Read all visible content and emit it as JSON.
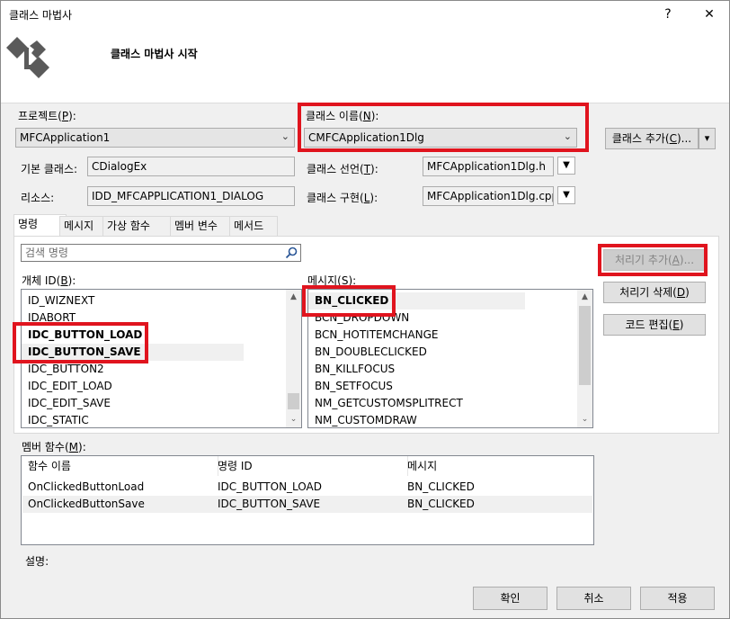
{
  "window": {
    "title": "클래스 마법사",
    "help_label": "?",
    "close_label": "✕"
  },
  "header": {
    "subtitle": "클래스 마법사 시작"
  },
  "project": {
    "label_prefix": "프로젝트(",
    "label_key": "P",
    "label_suffix": "):",
    "value": "MFCApplication1"
  },
  "class_name": {
    "label_prefix": "클래스 이름(",
    "label_key": "N",
    "label_suffix": "):",
    "value": "CMFCApplication1Dlg"
  },
  "add_class": {
    "label_prefix": "클래스 추가(",
    "label_key": "C",
    "label_suffix": ")...",
    "dropdown_glyph": "▾"
  },
  "base_class": {
    "label": "기본 클래스:",
    "value": "CDialogEx"
  },
  "class_decl": {
    "label_prefix": "클래스 선언(",
    "label_key": "T",
    "label_suffix": "):",
    "value": "MFCApplication1Dlg.h"
  },
  "resource": {
    "label": "리소스:",
    "value": "IDD_MFCAPPLICATION1_DIALOG"
  },
  "class_impl": {
    "label_prefix": "클래스 구현(",
    "label_key": "L",
    "label_suffix": "):",
    "value": "MFCApplication1Dlg.cpp"
  },
  "tabs": [
    "명령",
    "메시지",
    "가상 함수",
    "멤버 변수",
    "메서드"
  ],
  "search": {
    "placeholder": "검색 명령"
  },
  "object_ids": {
    "label_prefix": "개체 ID(",
    "label_key": "B",
    "label_suffix": "):",
    "items": [
      "ID_WIZNEXT",
      "IDABORT",
      "IDC_BUTTON_LOAD",
      "IDC_BUTTON_SAVE",
      "IDC_BUTTON2",
      "IDC_EDIT_LOAD",
      "IDC_EDIT_SAVE",
      "IDC_STATIC"
    ]
  },
  "messages": {
    "label_prefix": "메시지(",
    "label_key": "S",
    "label_suffix": "):",
    "items": [
      "BN_CLICKED",
      "BCN_DROPDOWN",
      "BCN_HOTITEMCHANGE",
      "BN_DOUBLECLICKED",
      "BN_KILLFOCUS",
      "BN_SETFOCUS",
      "NM_GETCUSTOMSPLITRECT",
      "NM_CUSTOMDRAW"
    ]
  },
  "buttons": {
    "add_handler_prefix": "처리기 추가(",
    "add_handler_key": "A",
    "add_handler_suffix": ")...",
    "delete_handler_prefix": "처리기 삭제(",
    "delete_handler_key": "D",
    "delete_handler_suffix": ")",
    "edit_code_prefix": "코드 편집(",
    "edit_code_key": "E",
    "edit_code_suffix": ")",
    "ok": "확인",
    "cancel": "취소",
    "apply": "적용"
  },
  "member_functions": {
    "label_prefix": "멤버 함수(",
    "label_key": "M",
    "label_suffix": "):",
    "columns": [
      "함수 이름",
      "명령 ID",
      "메시지"
    ],
    "rows": [
      [
        "OnClickedButtonLoad",
        "IDC_BUTTON_LOAD",
        "BN_CLICKED"
      ],
      [
        "OnClickedButtonSave",
        "IDC_BUTTON_SAVE",
        "BN_CLICKED"
      ]
    ]
  },
  "description": {
    "label": "설명:"
  },
  "colors": {
    "highlight_box": "#e0141e",
    "window_bg": "#f0f0f0"
  },
  "icons": {
    "wizard": "class-wizard-icon",
    "search": "search-icon"
  }
}
